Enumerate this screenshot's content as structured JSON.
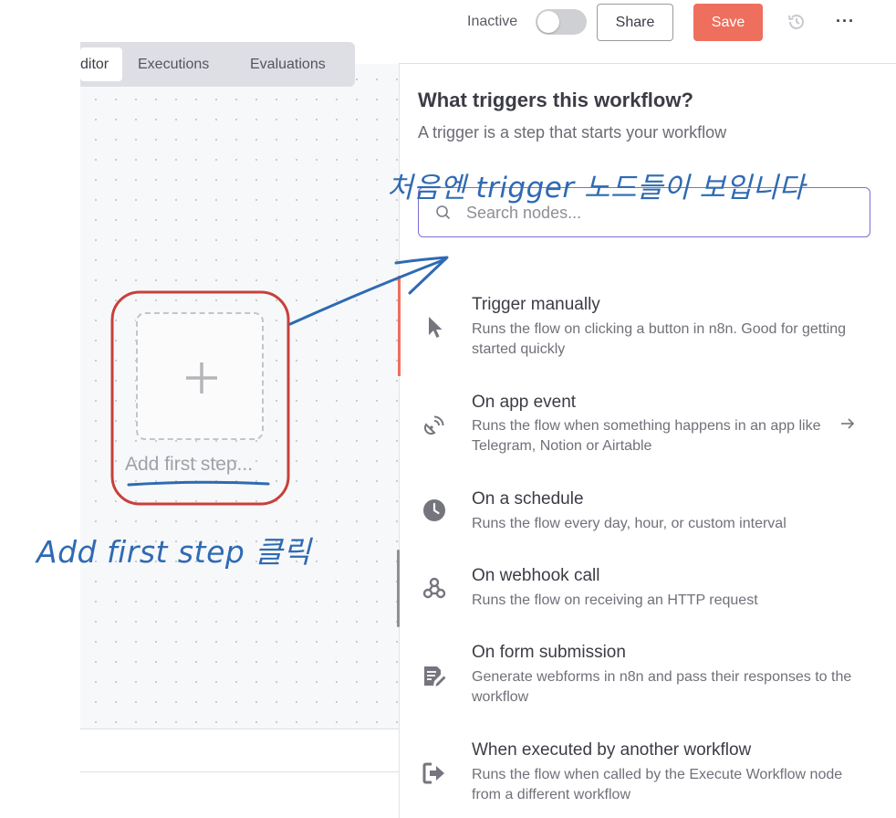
{
  "topbar": {
    "status_label": "Inactive",
    "share_label": "Share",
    "save_label": "Save",
    "more_glyph": "···",
    "colors": {
      "save": "#ee6f5d",
      "toggle_off": "#cfd0d4"
    }
  },
  "tabs": [
    {
      "label": "ditor",
      "active": true
    },
    {
      "label": "Executions",
      "active": false
    },
    {
      "label": "Evaluations",
      "active": false
    }
  ],
  "canvas": {
    "add_step_label": "Add first step..."
  },
  "panel": {
    "title": "What triggers this workflow?",
    "subtitle": "A trigger is a step that starts your workflow",
    "search_placeholder": "Search nodes...",
    "items": [
      {
        "icon": "cursor-icon",
        "title": "Trigger manually",
        "desc": "Runs the flow on clicking a button in n8n. Good for getting started quickly"
      },
      {
        "icon": "satellite-signal-icon",
        "title": "On app event",
        "desc": "Runs the flow when something happens in an app like Telegram, Notion or Airtable"
      },
      {
        "icon": "clock-icon",
        "title": "On a schedule",
        "desc": "Runs the flow every day, hour, or custom interval"
      },
      {
        "icon": "webhook-icon",
        "title": "On webhook call",
        "desc": "Runs the flow on receiving an HTTP request"
      },
      {
        "icon": "form-edit-icon",
        "title": "On form submission",
        "desc": "Generate webforms in n8n and pass their responses to the workflow"
      },
      {
        "icon": "sign-in-icon",
        "title": "When executed by another workflow",
        "desc": "Runs the flow when called by the Execute Workflow node from a different workflow"
      }
    ]
  },
  "annotations": {
    "top_note": "처음엔 trigger 노드들이 보입니다",
    "bottom_note": "Add first step 클릭",
    "colors": {
      "pen": "#2f6ab3",
      "highlight": "#c8403a"
    }
  }
}
